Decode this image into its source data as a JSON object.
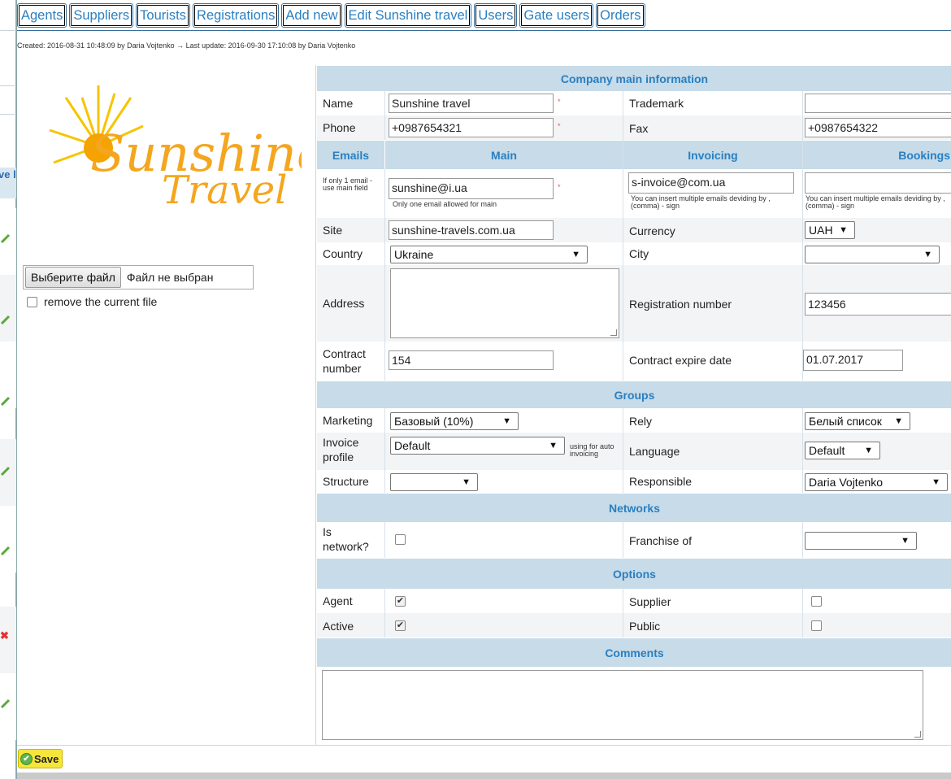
{
  "tabs": [
    "Agents",
    "Suppliers",
    "Tourists",
    "Registrations",
    "Add new",
    "Edit Sunshine travel",
    "Users",
    "Gate users",
    "Orders"
  ],
  "meta": "Created: 2016-08-31 10:48:09 by Daria Vojtenko → Last update: 2016-09-30 17:10:08 by Daria Vojtenko",
  "bg": {
    "col_header": "ve lic"
  },
  "logo": {
    "line1": "Sunshine",
    "line2": "Travel"
  },
  "file": {
    "button": "Выберите файл",
    "status": "Файл не выбран",
    "remove_label": "remove the current file"
  },
  "sections": {
    "main": "Company main information",
    "groups": "Groups",
    "networks": "Networks",
    "options": "Options",
    "comments": "Comments"
  },
  "fields": {
    "name_label": "Name",
    "name_value": "Sunshine travel",
    "trademark_label": "Trademark",
    "trademark_value": "",
    "phone_label": "Phone",
    "phone_value": "+0987654321",
    "fax_label": "Fax",
    "fax_value": "+0987654322",
    "emails_label": "Emails",
    "main_label": "Main",
    "invoicing_label": "Invoicing",
    "bookings_label": "Bookings",
    "email_hint": "If only 1 email - use main field",
    "email_main": "sunshine@i.ua",
    "email_main_note": "Only one email allowed for main",
    "email_invoice": "s-invoice@com.ua",
    "email_invoice_note": "You can insert multiple emails deviding by , (comma) - sign",
    "email_bookings": "",
    "email_bookings_note": "You can insert multiple emails deviding by , (comma) - sign",
    "site_label": "Site",
    "site_value": "sunshine-travels.com.ua",
    "currency_label": "Currency",
    "currency_value": "UAH",
    "country_label": "Country",
    "country_value": "Ukraine",
    "city_label": "City",
    "city_value": "",
    "address_label": "Address",
    "regnum_label": "Registration number",
    "regnum_value": "123456",
    "contract_label": "Contract number",
    "contract_value": "154",
    "contract_exp_label": "Contract expire date",
    "contract_exp_value": "01.07.2017",
    "marketing_label": "Marketing",
    "marketing_value": "Базовый (10%)",
    "rely_label": "Rely",
    "rely_value": "Белый список",
    "invoice_profile_label": "Invoice profile",
    "invoice_profile_value": "Default",
    "invoice_profile_note": "using for auto invoicing",
    "language_label": "Language",
    "language_value": "Default",
    "structure_label": "Structure",
    "structure_value": "",
    "responsible_label": "Responsible",
    "responsible_value": "Daria Vojtenko",
    "is_network_label": "Is network?",
    "franchise_label": "Franchise of",
    "franchise_value": "",
    "agent_label": "Agent",
    "supplier_label": "Supplier",
    "active_label": "Active",
    "public_label": "Public"
  },
  "options": {
    "agent": true,
    "supplier": false,
    "active": true,
    "public": false,
    "is_network": false
  },
  "save_label": "Save"
}
